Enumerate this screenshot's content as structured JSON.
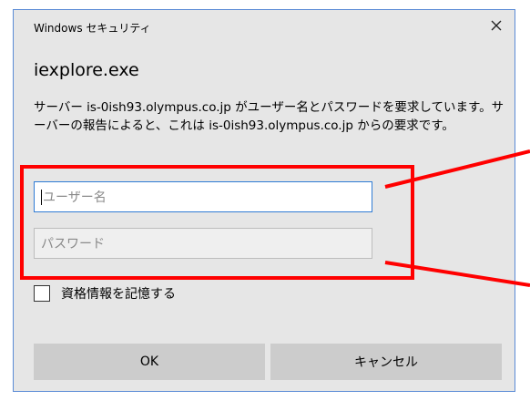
{
  "window": {
    "title": "Windows セキュリティ",
    "close_symbol": "✕"
  },
  "app": {
    "name": "iexplore.exe"
  },
  "message": {
    "text": "サーバー is-0ish93.olympus.co.jp がユーザー名とパスワードを要求しています。サーバーの報告によると、これは is-0ish93.olympus.co.jp からの要求です。"
  },
  "form": {
    "username_placeholder": "ユーザー名",
    "password_placeholder": "パスワード",
    "remember_label": "資格情報を記憶する"
  },
  "buttons": {
    "ok": "OK",
    "cancel": "キャンセル"
  },
  "colors": {
    "dialog_bg": "#e6e6e6",
    "dialog_border": "#5b8bd6",
    "focus_border": "#2f7bd4",
    "button_bg": "#cccccc",
    "annotation_red": "#ff0000"
  }
}
